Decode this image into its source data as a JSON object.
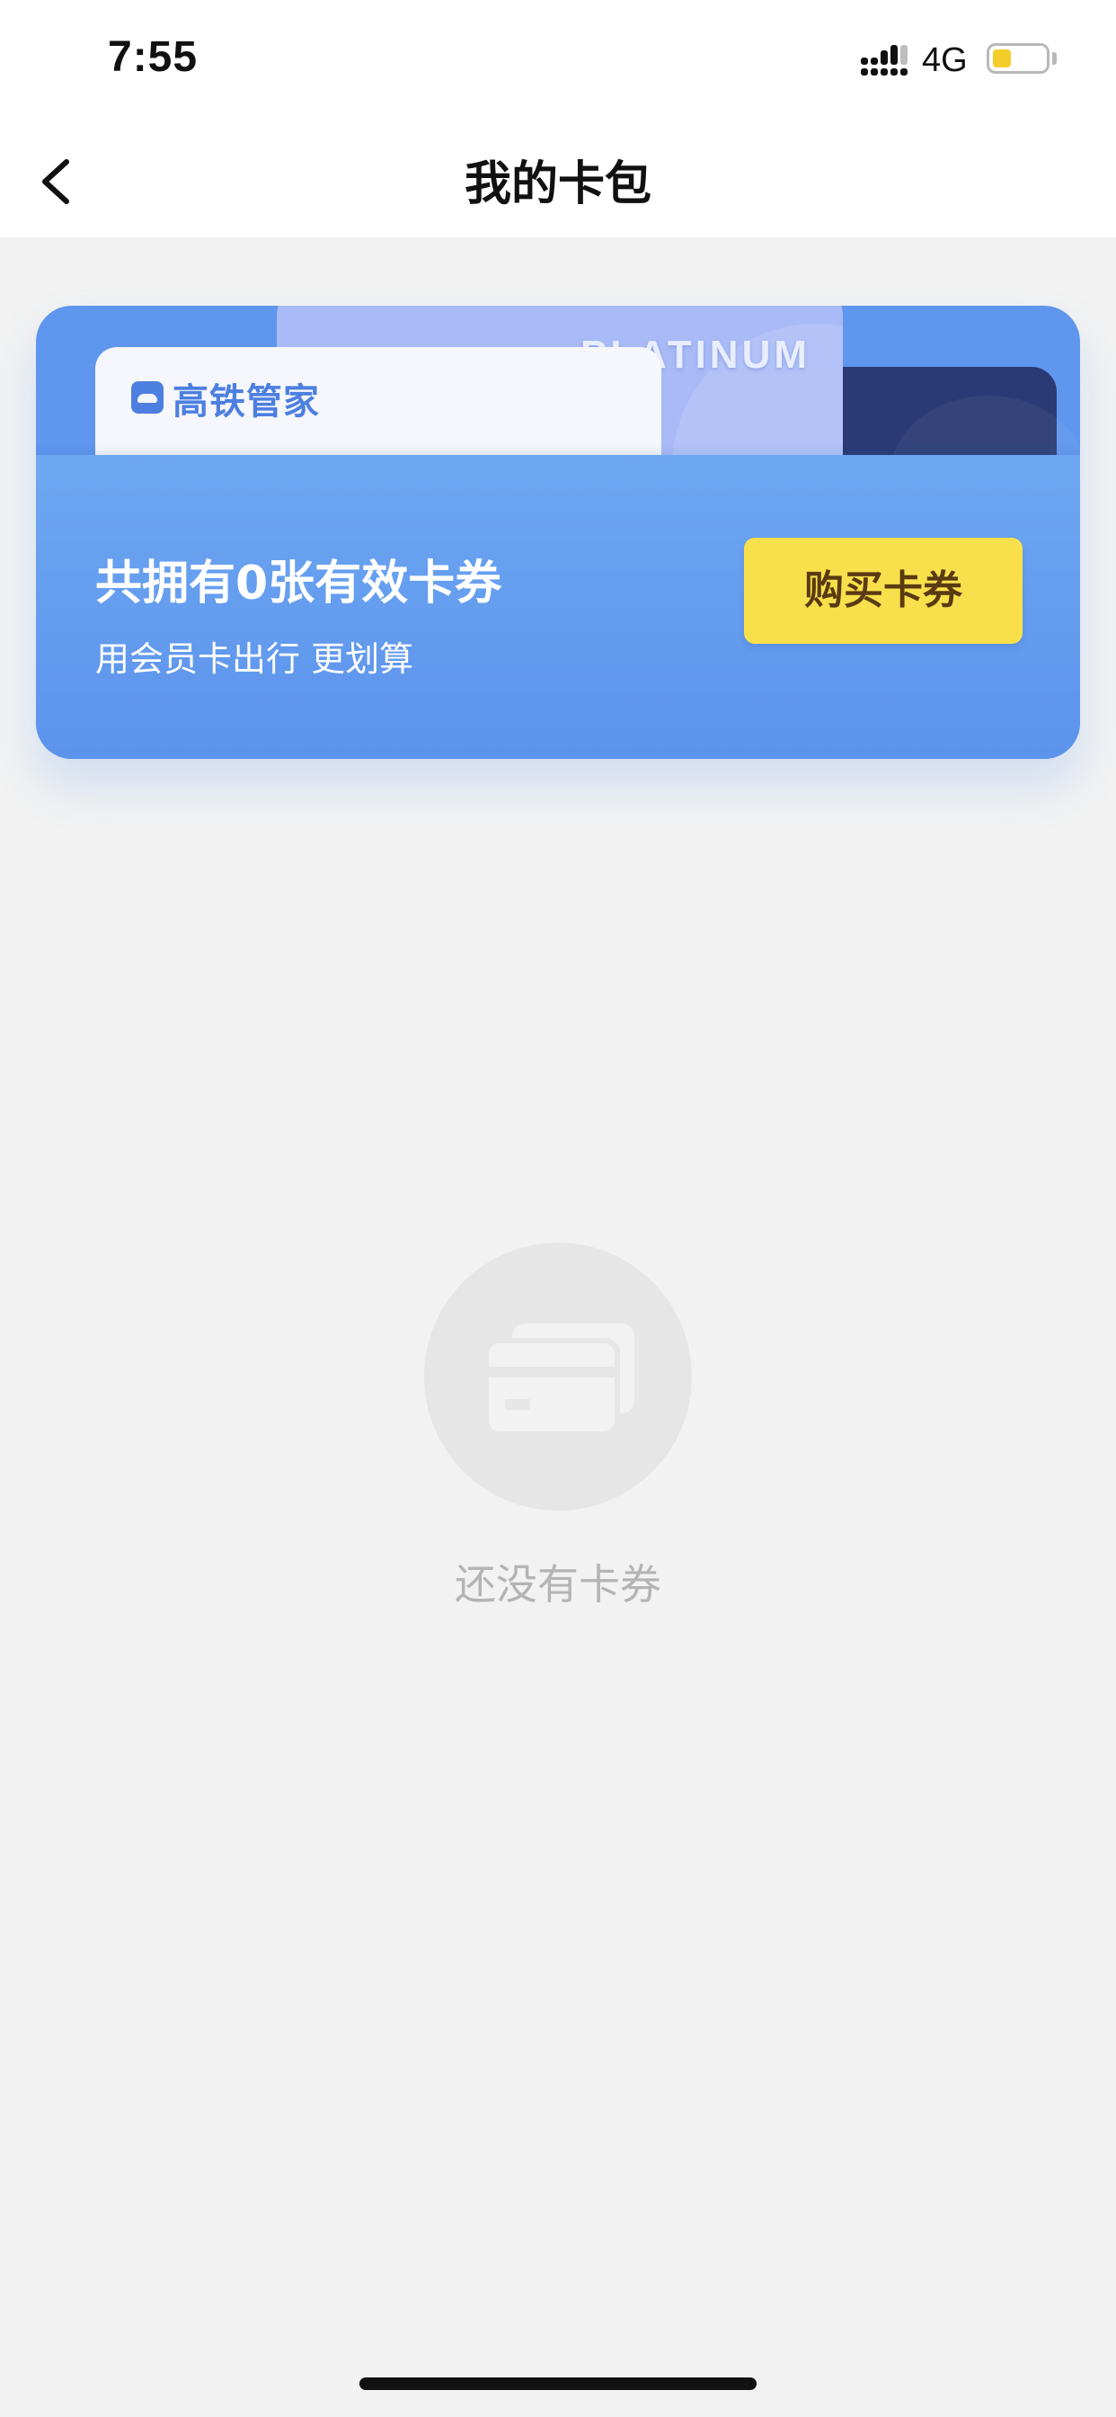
{
  "status_bar": {
    "time": "7:55",
    "network": "4G",
    "battery_level": 0.35
  },
  "nav": {
    "title": "我的卡包"
  },
  "wallet": {
    "brand_name": "高铁管家",
    "card_tier": "PLATINUM",
    "count_text": "共拥有0张有效卡券",
    "sub_text": "用会员卡出行 更划算",
    "buy_label": "购买卡券"
  },
  "empty_state": {
    "message": "还没有卡券"
  },
  "colors": {
    "wallet_blue": "#5f96ee",
    "buy_yellow": "#f7e04b",
    "buy_text": "#5a3a12",
    "brand_blue": "#4d7fe0",
    "background": "#f2f2f2"
  }
}
